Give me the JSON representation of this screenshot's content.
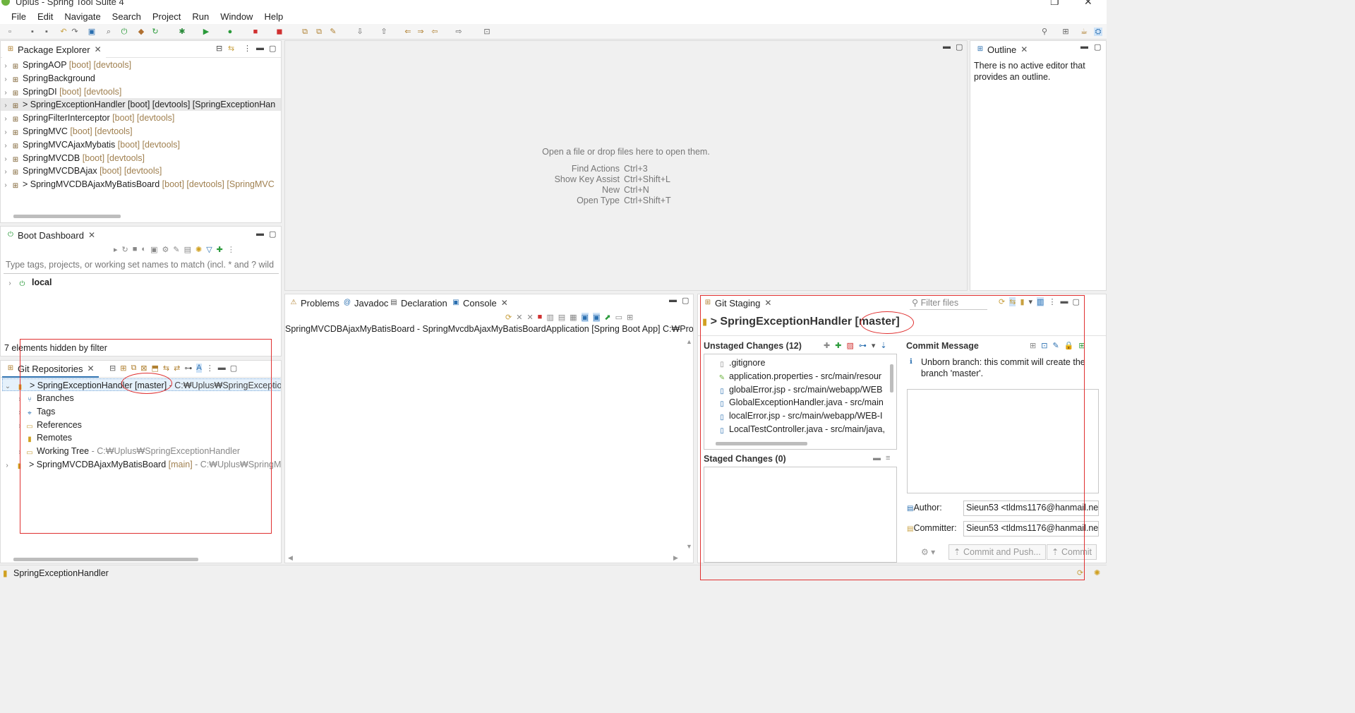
{
  "window": {
    "title": "Uplus - Spring Tool Suite 4"
  },
  "menu": [
    "File",
    "Edit",
    "Navigate",
    "Search",
    "Project",
    "Run",
    "Window",
    "Help"
  ],
  "package_explorer": {
    "tab": "Package Explorer",
    "projects": [
      {
        "name": "SpringAOP",
        "dec": "[boot] [devtools]"
      },
      {
        "name": "SpringBackground",
        "dec": ""
      },
      {
        "name": "SpringDI",
        "dec": "[boot] [devtools]"
      },
      {
        "name": "> SpringExceptionHandler [boot] [devtools] [SpringExceptionHan",
        "dec": ""
      },
      {
        "name": "SpringFilterInterceptor",
        "dec": "[boot] [devtools]"
      },
      {
        "name": "SpringMVC",
        "dec": "[boot] [devtools]"
      },
      {
        "name": "SpringMVCAjaxMybatis",
        "dec": "[boot] [devtools]"
      },
      {
        "name": "SpringMVCDB",
        "dec": "[boot] [devtools]"
      },
      {
        "name": "SpringMVCDBAjax",
        "dec": "[boot] [devtools]"
      },
      {
        "name": "> SpringMVCDBAjaxMyBatisBoard",
        "dec": "[boot] [devtools] [SpringMVC"
      }
    ]
  },
  "boot_dashboard": {
    "tab": "Boot Dashboard",
    "filter_placeholder": "Type tags, projects, or working set names to match (incl. * and ? wild",
    "local": "local",
    "hidden_msg": "7 elements hidden by filter"
  },
  "git_repositories": {
    "tab": "Git Repositories",
    "repo1": {
      "name": "> SpringExceptionHandler [master]",
      "path": " - C:₩Uplus₩SpringExceptionH"
    },
    "children": [
      {
        "label": "Branches",
        "path": ""
      },
      {
        "label": "Tags",
        "path": ""
      },
      {
        "label": "References",
        "path": ""
      },
      {
        "label": "Remotes",
        "path": ""
      },
      {
        "label": "Working Tree",
        "path": " - C:₩Uplus₩SpringExceptionHandler"
      }
    ],
    "repo2": {
      "name": "> SpringMVCDBAjaxMyBatisBoard",
      "branch": "[main]",
      "path": " - C:₩Uplus₩SpringMV"
    }
  },
  "editor": {
    "empty_msg": "Open a file or drop files here to open them.",
    "shortcuts": [
      {
        "label": "Find Actions",
        "key": "Ctrl+3"
      },
      {
        "label": "Show Key Assist",
        "key": "Ctrl+Shift+L"
      },
      {
        "label": "New",
        "key": "Ctrl+N"
      },
      {
        "label": "Open Type",
        "key": "Ctrl+Shift+T"
      }
    ]
  },
  "outline": {
    "tab": "Outline",
    "msg": "There is no active editor that provides an outline."
  },
  "console_panel": {
    "tabs": [
      "Problems",
      "Javadoc",
      "Declaration",
      "Console"
    ],
    "header": "SpringMVCDBAjaxMyBatisBoard - SpringMvcdbAjaxMyBatisBoardApplication [Spring Boot App] C:₩Proc"
  },
  "git_staging": {
    "tab": "Git Staging",
    "filter_placeholder": "Filter files",
    "repo_title": "> SpringExceptionHandler [master]",
    "unstaged_label": "Unstaged Changes (12)",
    "unstaged_files": [
      ".gitignore",
      "application.properties - src/main/resour",
      "globalError.jsp - src/main/webapp/WEB",
      "GlobalExceptionHandler.java - src/main",
      "localError.jsp - src/main/webapp/WEB-I",
      "LocalTestController.java - src/main/java,"
    ],
    "staged_label": "Staged Changes (0)",
    "commit_message_label": "Commit Message",
    "info": "Unborn branch: this commit will create the branch 'master'.",
    "author_label": "Author:",
    "author": "Sieun53 <tldms1176@hanmail.ne",
    "committer_label": "Committer:",
    "committer": "Sieun53 <tldms1176@hanmail.ne",
    "commit_push_btn": "Commit and Push...",
    "commit_btn": "Commit"
  },
  "status": {
    "text": "SpringExceptionHandler"
  },
  "colors": {
    "annotation": "#e03030",
    "decoration": "#a08050",
    "selection": "#e5f1fb"
  }
}
